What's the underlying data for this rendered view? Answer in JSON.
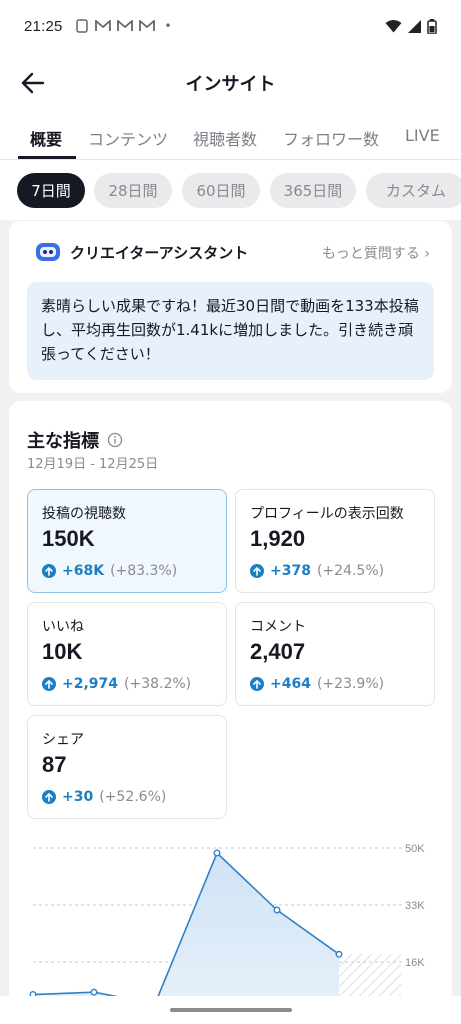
{
  "status_bar": {
    "time": "21:25",
    "dot": "•"
  },
  "nav": {
    "title": "インサイト"
  },
  "tabs": [
    "概要",
    "コンテンツ",
    "視聴者数",
    "フォロワー数",
    "LIVE"
  ],
  "period_chips": [
    "7日間",
    "28日間",
    "60日間",
    "365日間",
    "カスタム"
  ],
  "assistant": {
    "title": "クリエイターアシスタント",
    "more": "もっと質問する ›",
    "message": "素晴らしい成果ですね！最近30日間で動画を133本投稿し、平均再生回数が1.41kに増加しました。引き続き頑張ってください！"
  },
  "metrics": {
    "title": "主な指標",
    "date_range": "12月19日 - 12月25日",
    "items": [
      {
        "label": "投稿の視聴数",
        "value": "150K",
        "change": "+68K",
        "percent": "(+83.3%)"
      },
      {
        "label": "プロフィールの表示回数",
        "value": "1,920",
        "change": "+378",
        "percent": "(+24.5%)"
      },
      {
        "label": "いいね",
        "value": "10K",
        "change": "+2,974",
        "percent": "(+38.2%)"
      },
      {
        "label": "コメント",
        "value": "2,407",
        "change": "+464",
        "percent": "(+23.9%)"
      },
      {
        "label": "シェア",
        "value": "87",
        "change": "+30",
        "percent": "(+52.6%)"
      }
    ]
  },
  "chart_data": {
    "type": "area",
    "y_ticks": [
      "50K",
      "33K",
      "16K"
    ],
    "y_tick_values": [
      50000,
      33000,
      16000
    ],
    "values": [
      6300,
      7000,
      3500,
      48500,
      31500,
      18300
    ],
    "forecast": "hatched",
    "grid": true,
    "colors": {
      "line": "#2f82c8",
      "fill": "#d6e8f7"
    }
  }
}
